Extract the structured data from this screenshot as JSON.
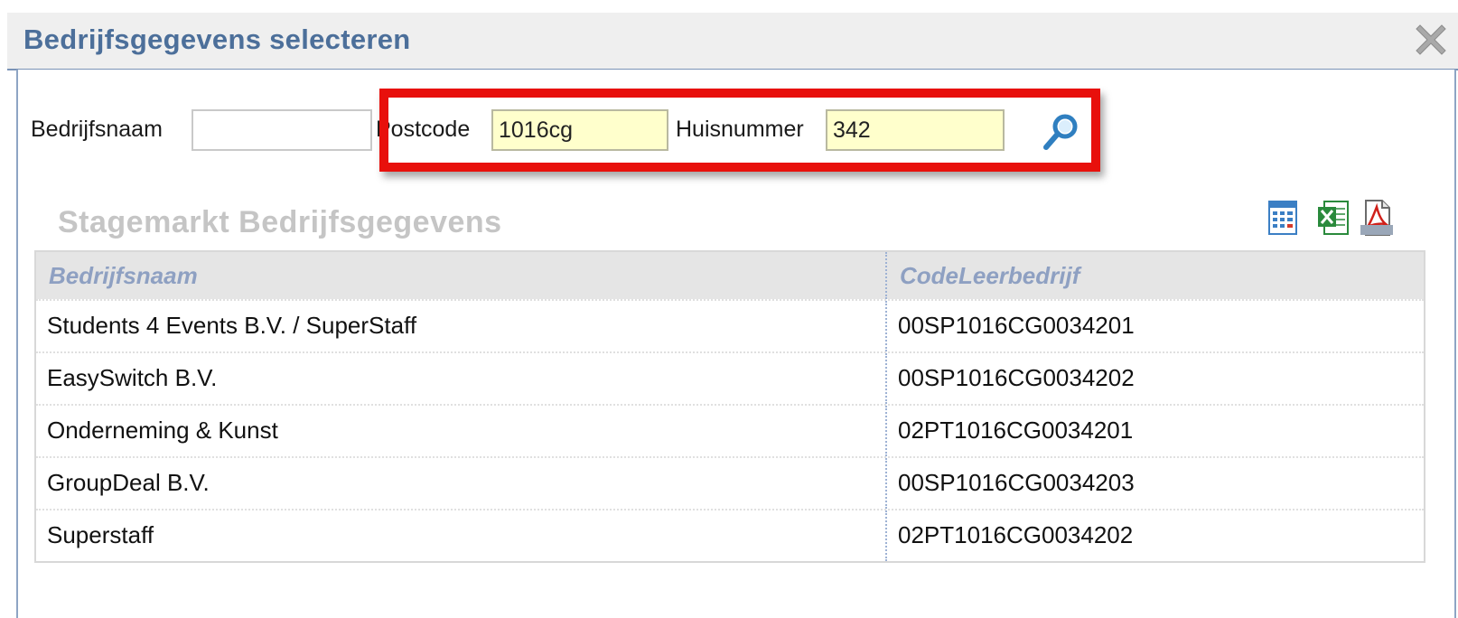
{
  "dialog": {
    "title": "Bedrijfsgegevens selecteren"
  },
  "search": {
    "company_label": "Bedrijfsnaam",
    "company_value": "",
    "postcode_label": "Postcode",
    "postcode_value": "1016cg",
    "housenumber_label": "Huisnummer",
    "housenumber_value": "342",
    "search_icon": "magnifier-icon"
  },
  "results": {
    "title": "Stagemarkt Bedrijfsgegevens",
    "export_icons": [
      "csv-export-icon",
      "excel-export-icon",
      "pdf-export-icon"
    ],
    "columns": [
      "Bedrijfsnaam",
      "CodeLeerbedrijf"
    ],
    "rows": [
      {
        "name": "Students 4 Events B.V. / SuperStaff",
        "code": "00SP1016CG0034201"
      },
      {
        "name": "EasySwitch B.V.",
        "code": "00SP1016CG0034202"
      },
      {
        "name": "Onderneming & Kunst",
        "code": "02PT1016CG0034201"
      },
      {
        "name": "GroupDeal B.V.",
        "code": "00SP1016CG0034203"
      },
      {
        "name": "Superstaff",
        "code": "02PT1016CG0034202"
      }
    ]
  },
  "colors": {
    "title": "#4c6f9a",
    "highlight_box": "#e8100c",
    "input_highlight": "#ffffcc",
    "header_text": "#8ea0c2"
  }
}
